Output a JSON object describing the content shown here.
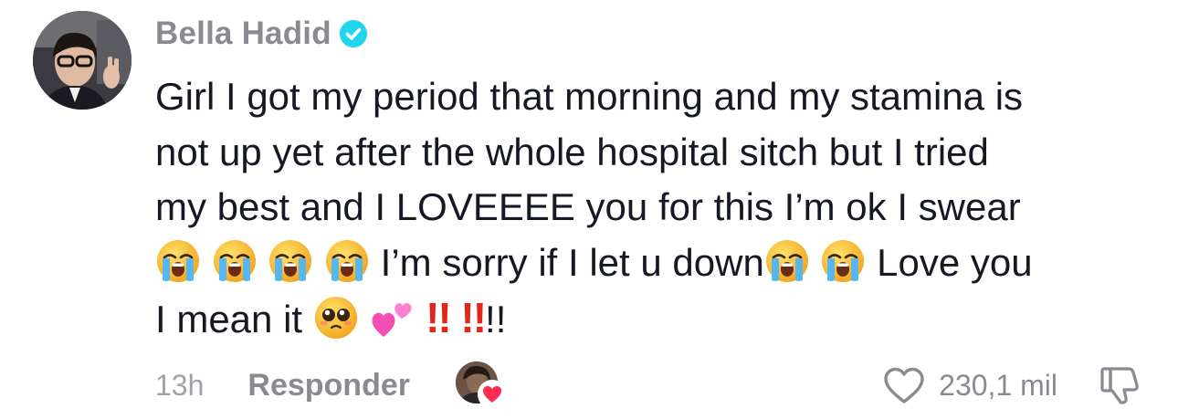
{
  "author": {
    "name": "Bella Hadid",
    "verified": true,
    "verified_color": "#20d5ec",
    "avatar_icon": "profile-photo"
  },
  "comment": {
    "line1": "Girl I got my period that morning and my stamina is",
    "line2": "not up yet after the whole hospital sitch but I tried",
    "line3": "my best and I LOVEEEE you for this I’m ok I swear",
    "line4_text_a": " I’m sorry if I let u down",
    "line4_text_b": " Love you",
    "line5_text": "I mean it ",
    "line5_bang1": "‼️",
    "line5_bang2": "‼️",
    "line5_tail": "!!",
    "emojis": [
      "loudly-crying-face",
      "pleading-face",
      "two-hearts"
    ]
  },
  "footer": {
    "time": "13h",
    "reply_label": "Responder",
    "creator_liked_icon": "creator-heart",
    "like_count": "230,1 mil",
    "heart_color": "#fe2c55"
  }
}
